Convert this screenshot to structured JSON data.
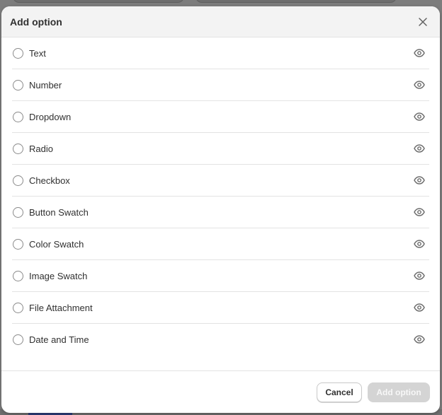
{
  "modal": {
    "title": "Add option",
    "close_icon": "close-icon"
  },
  "options": [
    {
      "label": "Text",
      "icon": "eye-icon"
    },
    {
      "label": "Number",
      "icon": "eye-icon"
    },
    {
      "label": "Dropdown",
      "icon": "eye-icon"
    },
    {
      "label": "Radio",
      "icon": "eye-icon"
    },
    {
      "label": "Checkbox",
      "icon": "eye-icon"
    },
    {
      "label": "Button Swatch",
      "icon": "eye-icon"
    },
    {
      "label": "Color Swatch",
      "icon": "eye-icon"
    },
    {
      "label": "Image Swatch",
      "icon": "eye-icon"
    },
    {
      "label": "File Attachment",
      "icon": "eye-icon"
    },
    {
      "label": "Date and Time",
      "icon": "eye-icon"
    }
  ],
  "footer": {
    "cancel_label": "Cancel",
    "submit_label": "Add option",
    "submit_disabled": true
  },
  "colors": {
    "header_bg": "#f3f3f3",
    "divider": "#e3e3e3",
    "disabled_button": "#d4d4d4"
  }
}
